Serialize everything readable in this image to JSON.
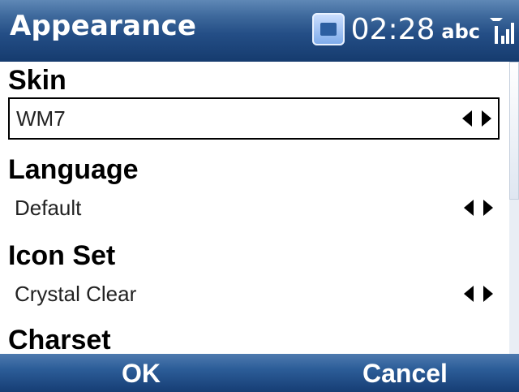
{
  "header": {
    "title": "Appearance",
    "time": "02:28",
    "input_mode": "abc",
    "icons": [
      "app-icon",
      "signal-icon"
    ]
  },
  "content": {
    "skin": {
      "label": "Skin",
      "value": "WM7",
      "selected": true
    },
    "language": {
      "label": "Language",
      "value": "Default"
    },
    "iconset": {
      "label": "Icon Set",
      "value": "Crystal Clear"
    },
    "charset": {
      "label": "Charset"
    }
  },
  "softkeys": {
    "left": "OK",
    "right": "Cancel"
  },
  "colors": {
    "title_bar": "#244e86",
    "softkey_bar": "#2c5d98",
    "background": "#ffffff",
    "text": "#000000"
  }
}
